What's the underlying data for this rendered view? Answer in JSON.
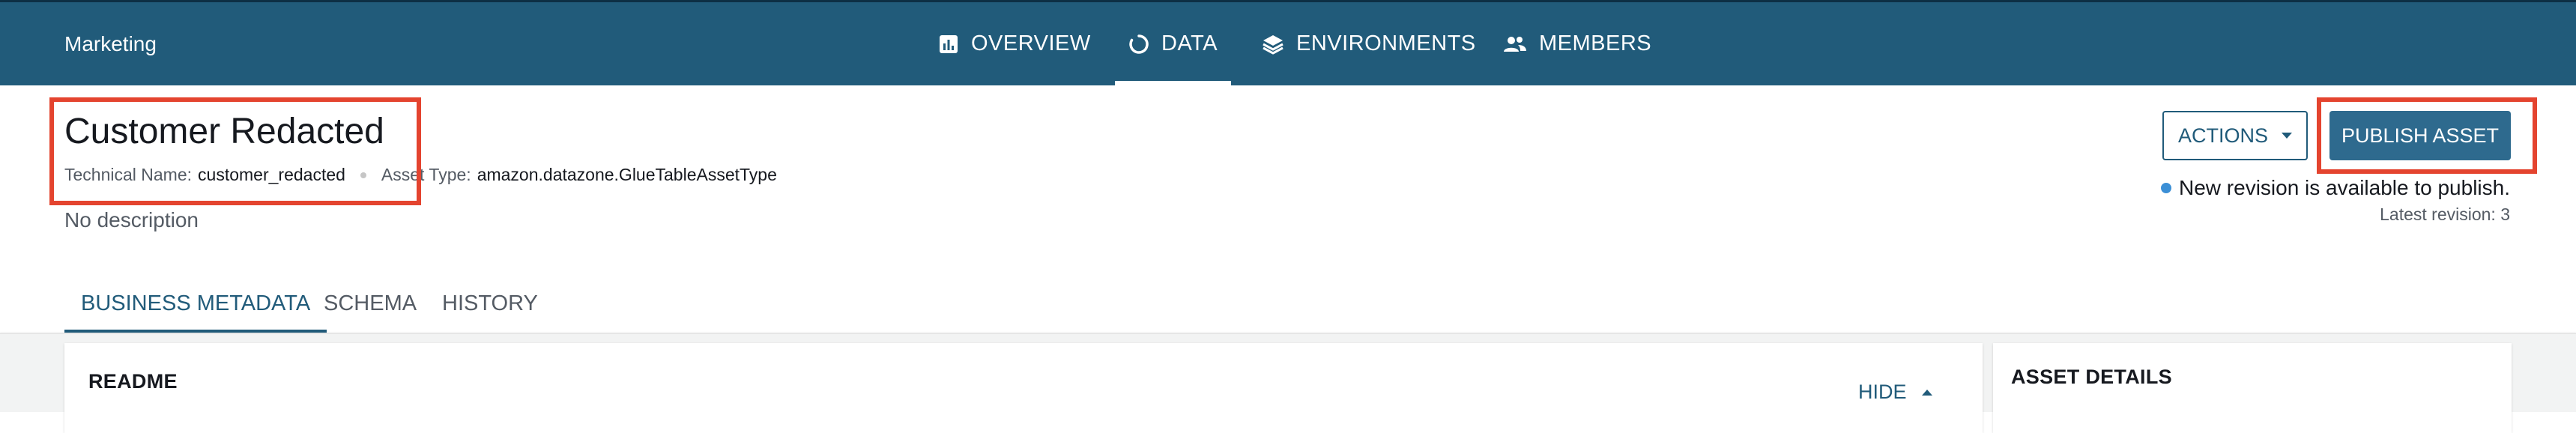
{
  "header": {
    "brand": "Marketing",
    "nav": [
      {
        "label": "OVERVIEW",
        "icon": "bar-chart-icon",
        "active": false
      },
      {
        "label": "DATA",
        "icon": "loading-circle-icon",
        "active": true
      },
      {
        "label": "ENVIRONMENTS",
        "icon": "layers-icon",
        "active": false
      },
      {
        "label": "MEMBERS",
        "icon": "people-icon",
        "active": false
      }
    ]
  },
  "asset": {
    "title": "Customer Redacted",
    "technical_name_label": "Technical Name:",
    "technical_name": "customer_redacted",
    "asset_type_label": "Asset Type:",
    "asset_type": "amazon.datazone.GlueTableAssetType",
    "description": "No description"
  },
  "actions": {
    "actions_label": "ACTIONS",
    "publish_label": "PUBLISH ASSET",
    "revision_notice": "New revision is available to publish.",
    "latest_revision": "Latest revision: 3"
  },
  "tabs": [
    {
      "label": "BUSINESS METADATA",
      "active": true
    },
    {
      "label": "SCHEMA",
      "active": false
    },
    {
      "label": "HISTORY",
      "active": false
    }
  ],
  "content": {
    "readme_title": "README",
    "hide_label": "HIDE",
    "asset_details_title": "ASSET DETAILS"
  },
  "colors": {
    "nav_bg": "#215b7a",
    "accent": "#215b7a",
    "publish_bg": "#2e6a8e",
    "highlight": "#e4442f",
    "revision_dot": "#3b8fd6"
  }
}
